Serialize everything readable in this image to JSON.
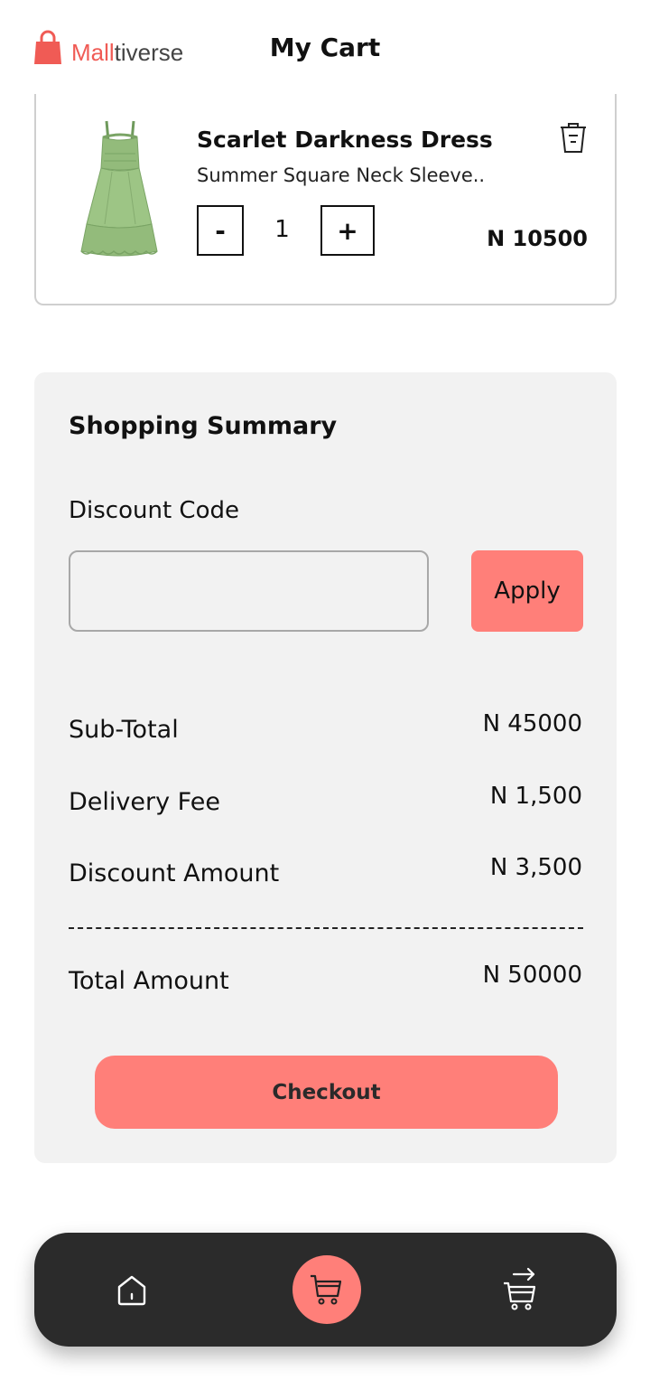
{
  "brand": {
    "part1": "Mall",
    "part2": "tiverse"
  },
  "header": {
    "title": "My Cart"
  },
  "cart_item": {
    "title": "Scarlet Darkness Dress",
    "description": "Summer Square Neck Sleeve..",
    "quantity": "1",
    "minus_label": "-",
    "plus_label": "+",
    "price": "N 10500"
  },
  "summary": {
    "title": "Shopping Summary",
    "discount_label": "Discount Code",
    "discount_placeholder": "",
    "apply_label": "Apply",
    "subtotal_label": "Sub-Total",
    "subtotal_value": "N 45000",
    "delivery_label": "Delivery Fee",
    "delivery_value": "N 1,500",
    "discount_amount_label": "Discount Amount",
    "discount_amount_value": "N 3,500",
    "total_label": "Total Amount",
    "total_value": "N 50000",
    "checkout_label": "Checkout"
  },
  "nav": {
    "items": [
      {
        "icon": "home-icon"
      },
      {
        "icon": "cart-icon",
        "active": true
      },
      {
        "icon": "orders-icon"
      }
    ]
  },
  "colors": {
    "accent": "#ff7f79",
    "brand_red": "#f05b55",
    "nav_bg": "#2b2b2b",
    "summary_bg": "#f2f2f2"
  }
}
